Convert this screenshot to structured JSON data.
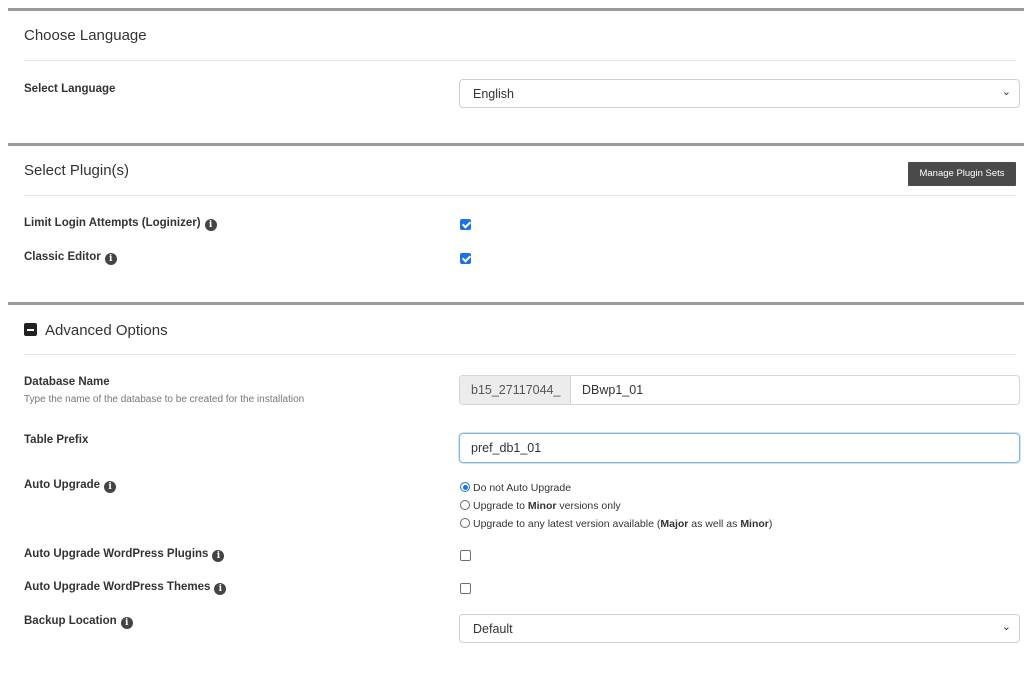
{
  "choose_language": {
    "title": "Choose Language",
    "select_label": "Select Language",
    "select_value": "English"
  },
  "plugins": {
    "title": "Select Plugin(s)",
    "manage_button": "Manage Plugin Sets",
    "items": [
      {
        "label": "Limit Login Attempts (Loginizer)",
        "checked": true
      },
      {
        "label": "Classic Editor",
        "checked": true
      }
    ]
  },
  "advanced": {
    "title": "Advanced Options",
    "database": {
      "label": "Database Name",
      "help": "Type the name of the database to be created for the installation",
      "prefix": "b15_27117044_",
      "value": "DBwp1_01"
    },
    "table_prefix": {
      "label": "Table Prefix",
      "value": "pref_db1_01"
    },
    "auto_upgrade": {
      "label": "Auto Upgrade",
      "options": [
        {
          "text": "Do not Auto Upgrade",
          "selected": true
        },
        {
          "pre": "Upgrade to ",
          "bold": "Minor",
          "post": " versions only",
          "selected": false
        },
        {
          "pre": "Upgrade to any latest version available (",
          "bold": "Major",
          "mid": " as well as ",
          "bold2": "Minor",
          "post": ")",
          "selected": false
        }
      ]
    },
    "auto_upgrade_plugins": {
      "label": "Auto Upgrade WordPress Plugins",
      "checked": false
    },
    "auto_upgrade_themes": {
      "label": "Auto Upgrade WordPress Themes",
      "checked": false
    },
    "backup_location": {
      "label": "Backup Location",
      "value": "Default"
    }
  },
  "icons": {
    "info": "info-circle-icon",
    "collapse": "minus-square-icon",
    "dropdown": "chevron-down-icon"
  },
  "colors": {
    "accent": "#1a73e8",
    "button_dark": "#4a4a4a",
    "section_border": "#9a9a9a"
  }
}
